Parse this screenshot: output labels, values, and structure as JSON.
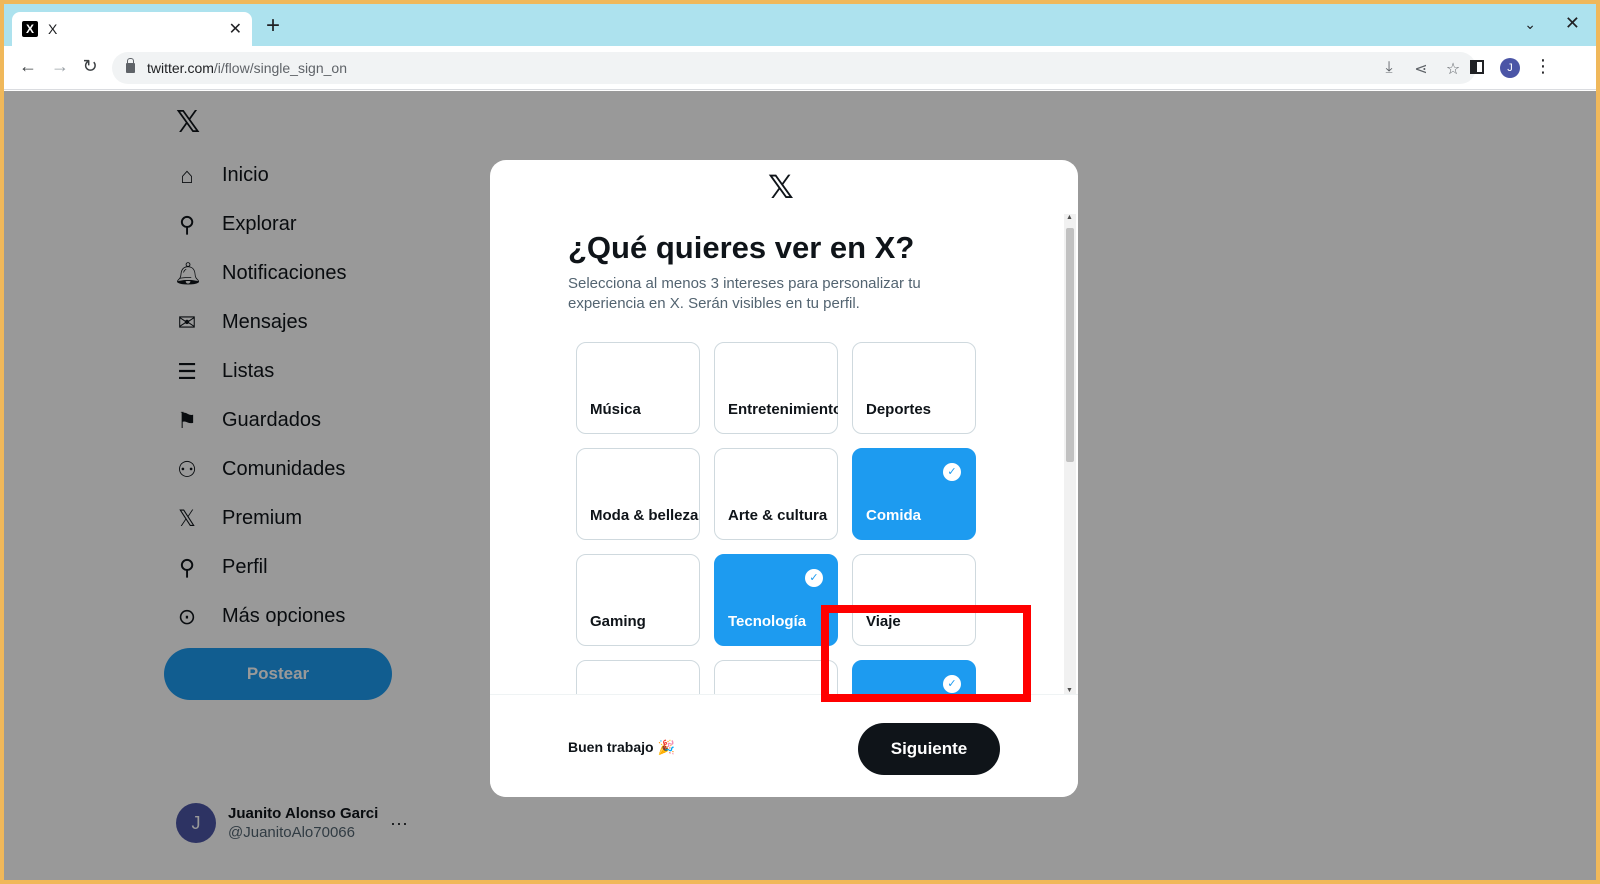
{
  "browser": {
    "tab_title": "X",
    "tab_favicon": "X",
    "url_host": "twitter.com",
    "url_path": "/i/flow/single_sign_on",
    "profile_initial": "J"
  },
  "sidebar": {
    "logo": "𝕏",
    "items": [
      {
        "label": "Inicio",
        "icon": "home-icon"
      },
      {
        "label": "Explorar",
        "icon": "search-icon"
      },
      {
        "label": "Notificaciones",
        "icon": "bell-icon"
      },
      {
        "label": "Mensajes",
        "icon": "envelope-icon"
      },
      {
        "label": "Listas",
        "icon": "list-icon"
      },
      {
        "label": "Guardados",
        "icon": "bookmark-icon"
      },
      {
        "label": "Comunidades",
        "icon": "people-icon"
      },
      {
        "label": "Premium",
        "icon": "x-icon"
      },
      {
        "label": "Perfil",
        "icon": "person-icon"
      },
      {
        "label": "Más opciones",
        "icon": "more-circle-icon"
      }
    ],
    "post_label": "Postear",
    "account": {
      "initial": "J",
      "name": "Juanito Alonso Garcia",
      "handle": "@JuanitoAlo70066",
      "more": "···"
    }
  },
  "modal": {
    "logo": "𝕏",
    "title": "¿Qué quieres ver en X?",
    "subtitle": "Selecciona al menos 3 intereses para personalizar tu experiencia en X. Serán visibles en tu perfil.",
    "interests": [
      {
        "label": "Música",
        "selected": false
      },
      {
        "label": "Entretenimiento",
        "selected": false
      },
      {
        "label": "Deportes",
        "selected": false
      },
      {
        "label": "Moda & belleza",
        "selected": false
      },
      {
        "label": "Arte & cultura",
        "selected": false
      },
      {
        "label": "Comida",
        "selected": true
      },
      {
        "label": "Gaming",
        "selected": false
      },
      {
        "label": "Tecnología",
        "selected": true
      },
      {
        "label": "Viaje",
        "selected": false
      },
      {
        "label": "",
        "selected": false
      },
      {
        "label": "",
        "selected": false
      },
      {
        "label": "",
        "selected": true
      }
    ],
    "check_glyph": "✓",
    "footer_message": "Buen trabajo 🎉",
    "next_label": "Siguiente"
  },
  "colors": {
    "accent": "#1d9bf0",
    "highlight": "#ff0000",
    "dark_button": "#0f1419"
  }
}
